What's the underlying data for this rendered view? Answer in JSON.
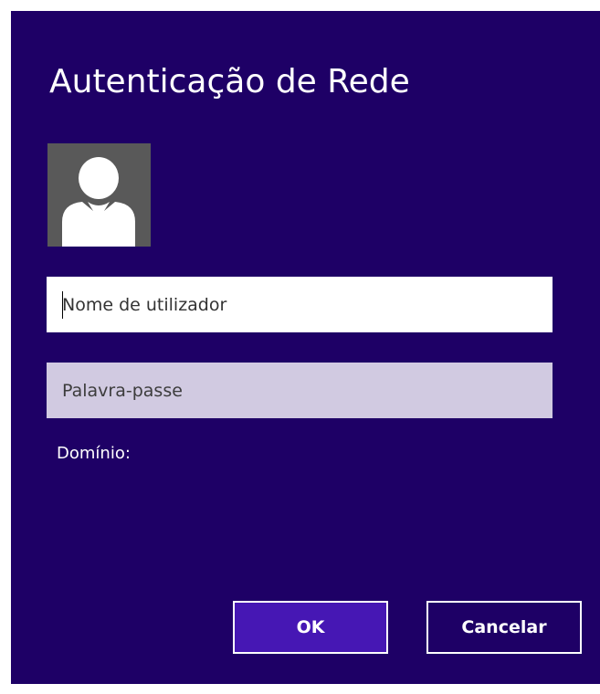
{
  "dialog": {
    "title": "Autenticação de Rede",
    "avatar_icon": "user-silhouette-icon",
    "username": {
      "value": "",
      "placeholder": "Nome de utilizador"
    },
    "password": {
      "value": "",
      "placeholder": "Palavra-passe"
    },
    "domain_label": "Domínio:",
    "ok_label": "OK",
    "cancel_label": "Cancelar"
  },
  "colors": {
    "background": "#1e0066",
    "ok_button": "#4617b4",
    "password_field": "#d1cae1",
    "avatar_tile": "#595959",
    "text": "#ffffff"
  }
}
